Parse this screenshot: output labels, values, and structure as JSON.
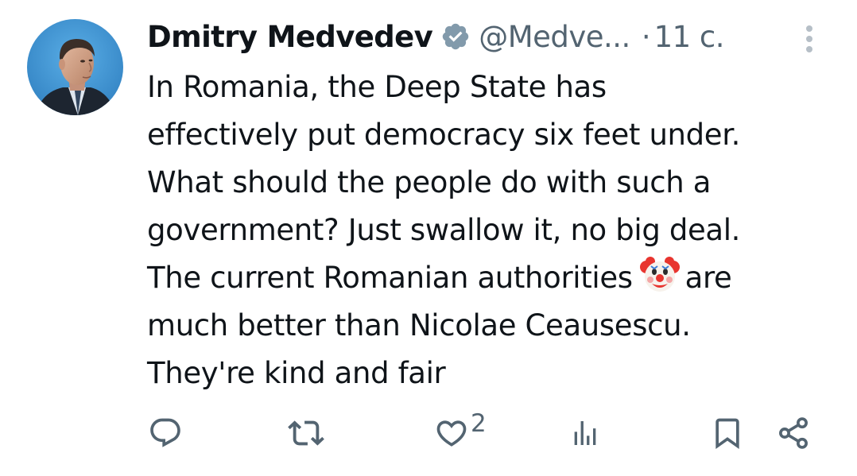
{
  "tweet": {
    "display_name": "Dmitry Medvedev",
    "handle": "@Medve...",
    "separator": "·",
    "time": "11 с.",
    "body_lines": [
      "In Romania, the Deep State has",
      "effectively put democracy six feet under.",
      "What should the people do with such a",
      "government? Just swallow it, no big deal.",
      "The current Romanian authorities",
      "are",
      "much better than Nicolae Ceausescu.",
      "They're kind and fair"
    ],
    "inline_emoji": "clown-face-emoji"
  },
  "actions": {
    "reply": {
      "icon": "reply-icon"
    },
    "retweet": {
      "icon": "retweet-icon"
    },
    "like": {
      "icon": "heart-icon",
      "count": "2"
    },
    "views": {
      "icon": "views-icon"
    },
    "bookmark": {
      "icon": "bookmark-icon"
    },
    "share": {
      "icon": "share-icon"
    }
  },
  "colors": {
    "text": "#0f1419",
    "secondary": "#536471",
    "verified_badge": "#829aab",
    "avatar_bg": "#3a8fd0"
  }
}
